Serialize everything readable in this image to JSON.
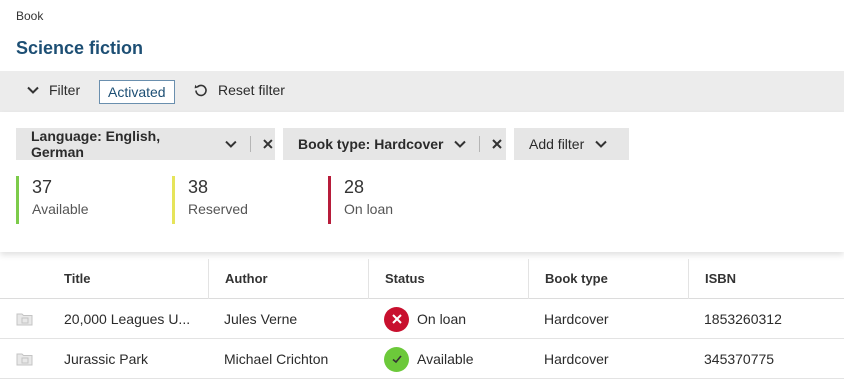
{
  "breadcrumb": "Book",
  "page_title": "Science fiction",
  "toolbar": {
    "filter_label": "Filter",
    "activated_label": "Activated",
    "reset_label": "Reset filter"
  },
  "filters": [
    {
      "label": "Language: English, German"
    },
    {
      "label": "Book type: Hardcover"
    }
  ],
  "add_filter_label": "Add filter",
  "stats": [
    {
      "value": "37",
      "label": "Available",
      "color": "#7ccb4a"
    },
    {
      "value": "38",
      "label": "Reserved",
      "color": "#e6e45a"
    },
    {
      "value": "28",
      "label": "On loan",
      "color": "#b71c3a"
    }
  ],
  "table": {
    "columns": [
      "Title",
      "Author",
      "Status",
      "Book type",
      "ISBN"
    ],
    "rows": [
      {
        "title": "20,000 Leagues U...",
        "author": "Jules Verne",
        "status": "On loan",
        "status_icon": "x-circle-icon",
        "status_color": "#c8102e",
        "book_type": "Hardcover",
        "isbn": "1853260312"
      },
      {
        "title": "Jurassic Park",
        "author": "Michael Crichton",
        "status": "Available",
        "status_icon": "check-circle-icon",
        "status_color": "#6cc93a",
        "book_type": "Hardcover",
        "isbn": "345370775"
      }
    ]
  }
}
